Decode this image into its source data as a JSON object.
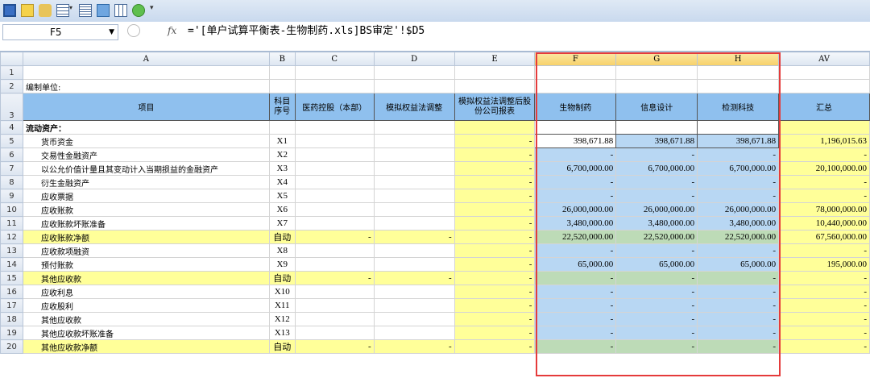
{
  "namebox": {
    "cell": "F5"
  },
  "formula_bar": {
    "fx": "fx",
    "formula": "='[单户试算平衡表-生物制药.xls]BS审定'!$D5"
  },
  "columns": [
    "A",
    "B",
    "C",
    "D",
    "E",
    "F",
    "G",
    "H",
    "AV"
  ],
  "sheet": {
    "row2_label": "编制单位:",
    "headers": {
      "A": "项目",
      "B": "科目序号",
      "C": "医药控股（本部）",
      "D": "模拟权益法调整",
      "E": "模拟权益法调整后股份公司报表",
      "F": "生物制药",
      "G": "信息设计",
      "H": "检测科技",
      "AV": "汇总"
    },
    "section_label": "流动资产：",
    "rows": [
      {
        "n": "5",
        "item": "货币资金",
        "code": "X1",
        "C": "",
        "D": "",
        "E": "-",
        "F": "398,671.88",
        "G": "398,671.88",
        "H": "398,671.88",
        "AV": "1,196,015.63",
        "style": "plain"
      },
      {
        "n": "6",
        "item": "交易性金融资产",
        "code": "X2",
        "C": "",
        "D": "",
        "E": "-",
        "F": "-",
        "G": "-",
        "H": "-",
        "AV": "-",
        "style": "plain"
      },
      {
        "n": "7",
        "item": "以公允价值计量且其变动计入当期损益的金融资产",
        "code": "X3",
        "C": "",
        "D": "",
        "E": "-",
        "F": "6,700,000.00",
        "G": "6,700,000.00",
        "H": "6,700,000.00",
        "AV": "20,100,000.00",
        "style": "plain"
      },
      {
        "n": "8",
        "item": "衍生金融资产",
        "code": "X4",
        "C": "",
        "D": "",
        "E": "-",
        "F": "-",
        "G": "-",
        "H": "-",
        "AV": "-",
        "style": "plain"
      },
      {
        "n": "9",
        "item": "应收票据",
        "code": "X5",
        "C": "",
        "D": "",
        "E": "-",
        "F": "-",
        "G": "-",
        "H": "-",
        "AV": "-",
        "style": "plain"
      },
      {
        "n": "10",
        "item": "应收账款",
        "code": "X6",
        "C": "",
        "D": "",
        "E": "-",
        "F": "26,000,000.00",
        "G": "26,000,000.00",
        "H": "26,000,000.00",
        "AV": "78,000,000.00",
        "style": "plain"
      },
      {
        "n": "11",
        "item": "应收账款坏账准备",
        "code": "X7",
        "C": "",
        "D": "",
        "E": "-",
        "F": "3,480,000.00",
        "G": "3,480,000.00",
        "H": "3,480,000.00",
        "AV": "10,440,000.00",
        "style": "plain"
      },
      {
        "n": "12",
        "item": "应收账款净额",
        "code": "自动",
        "C": "-",
        "D": "-",
        "E": "-",
        "F": "22,520,000.00",
        "G": "22,520,000.00",
        "H": "22,520,000.00",
        "AV": "67,560,000.00",
        "style": "auto"
      },
      {
        "n": "13",
        "item": "应收款项融资",
        "code": "X8",
        "C": "",
        "D": "",
        "E": "-",
        "F": "-",
        "G": "-",
        "H": "-",
        "AV": "-",
        "style": "plain"
      },
      {
        "n": "14",
        "item": "预付账款",
        "code": "X9",
        "C": "",
        "D": "",
        "E": "-",
        "F": "65,000.00",
        "G": "65,000.00",
        "H": "65,000.00",
        "AV": "195,000.00",
        "style": "plain"
      },
      {
        "n": "15",
        "item": "其他应收款",
        "code": "自动",
        "C": "-",
        "D": "-",
        "E": "-",
        "F": "-",
        "G": "-",
        "H": "-",
        "AV": "-",
        "style": "auto"
      },
      {
        "n": "16",
        "item": "应收利息",
        "code": "X10",
        "C": "",
        "D": "",
        "E": "-",
        "F": "-",
        "G": "-",
        "H": "-",
        "AV": "-",
        "style": "plain"
      },
      {
        "n": "17",
        "item": "应收股利",
        "code": "X11",
        "C": "",
        "D": "",
        "E": "-",
        "F": "-",
        "G": "-",
        "H": "-",
        "AV": "-",
        "style": "plain"
      },
      {
        "n": "18",
        "item": "其他应收款",
        "code": "X12",
        "C": "",
        "D": "",
        "E": "-",
        "F": "-",
        "G": "-",
        "H": "-",
        "AV": "-",
        "style": "plain"
      },
      {
        "n": "19",
        "item": "其他应收款坏账准备",
        "code": "X13",
        "C": "",
        "D": "",
        "E": "-",
        "F": "-",
        "G": "-",
        "H": "-",
        "AV": "-",
        "style": "plain"
      },
      {
        "n": "20",
        "item": "其他应收款净额",
        "code": "自动",
        "C": "-",
        "D": "-",
        "E": "-",
        "F": "-",
        "G": "-",
        "H": "-",
        "AV": "-",
        "style": "auto"
      }
    ]
  }
}
